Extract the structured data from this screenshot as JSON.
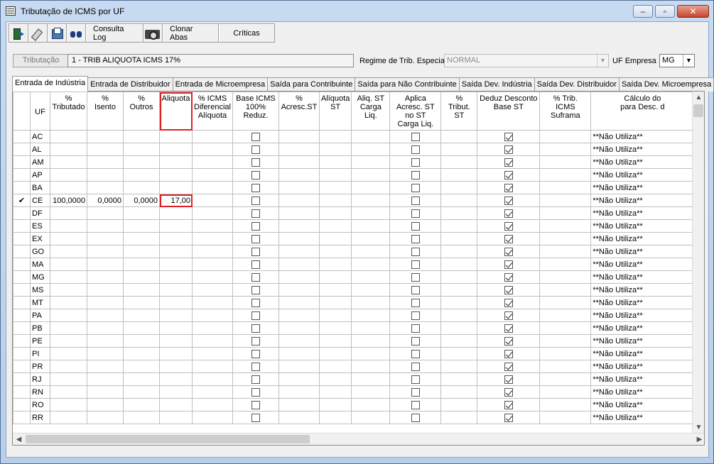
{
  "window": {
    "title": "Tributação de ICMS por UF"
  },
  "toolbar": {
    "consulta_log": "Consulta Log",
    "clonar_abas": "Clonar Abas",
    "criticas": "Críticas"
  },
  "form": {
    "tributacao_label": "Tributação",
    "tributacao_value": "1  -  TRIB ALIQUOTA ICMS 17%",
    "regime_label": "Regime de Trib. Especial",
    "regime_value": "NORMAL",
    "uf_empresa_label": "UF Empresa",
    "uf_empresa_value": "MG"
  },
  "tabs": [
    {
      "label": "Entrada de Indústria"
    },
    {
      "label": "Entrada de Distribuidor"
    },
    {
      "label": "Entrada de Microempresa"
    },
    {
      "label": "Saída para Contribuinte"
    },
    {
      "label": "Saída para Não Contribuinte"
    },
    {
      "label": "Saída Dev. Indústria"
    },
    {
      "label": "Saída Dev. Distribuidor"
    },
    {
      "label": "Saída Dev. Microempresa"
    }
  ],
  "grid": {
    "columns": [
      "UF",
      "%\nTributado",
      "%\nIsento",
      "%\nOutros",
      "Aliquota",
      "% ICMS\nDiferencial\nAlíquota",
      "Base ICMS\n100% Reduz.",
      "%\nAcresc.ST",
      "Alíquota\nST",
      "Aliq. ST\nCarga Liq.",
      "Aplica\nAcresc. ST\nno ST\nCarga Liq.",
      "%\nTribut. ST",
      "Deduz Desconto\nBase ST",
      "% Trib.\nICMS Suframa",
      "Cálculo do\npara Desc. d"
    ],
    "calc_text": "**Não Utiliza**",
    "rows": [
      {
        "uf": "AC",
        "trib": "",
        "isento": "",
        "outros": "",
        "aliq": "",
        "current": false
      },
      {
        "uf": "AL",
        "trib": "",
        "isento": "",
        "outros": "",
        "aliq": "",
        "current": false
      },
      {
        "uf": "AM",
        "trib": "",
        "isento": "",
        "outros": "",
        "aliq": "",
        "current": false
      },
      {
        "uf": "AP",
        "trib": "",
        "isento": "",
        "outros": "",
        "aliq": "",
        "current": false
      },
      {
        "uf": "BA",
        "trib": "",
        "isento": "",
        "outros": "",
        "aliq": "",
        "current": false
      },
      {
        "uf": "CE",
        "trib": "100,0000",
        "isento": "0,0000",
        "outros": "0,0000",
        "aliq": "17,00",
        "current": true
      },
      {
        "uf": "DF",
        "trib": "",
        "isento": "",
        "outros": "",
        "aliq": "",
        "current": false
      },
      {
        "uf": "ES",
        "trib": "",
        "isento": "",
        "outros": "",
        "aliq": "",
        "current": false
      },
      {
        "uf": "EX",
        "trib": "",
        "isento": "",
        "outros": "",
        "aliq": "",
        "current": false
      },
      {
        "uf": "GO",
        "trib": "",
        "isento": "",
        "outros": "",
        "aliq": "",
        "current": false
      },
      {
        "uf": "MA",
        "trib": "",
        "isento": "",
        "outros": "",
        "aliq": "",
        "current": false
      },
      {
        "uf": "MG",
        "trib": "",
        "isento": "",
        "outros": "",
        "aliq": "",
        "current": false
      },
      {
        "uf": "MS",
        "trib": "",
        "isento": "",
        "outros": "",
        "aliq": "",
        "current": false
      },
      {
        "uf": "MT",
        "trib": "",
        "isento": "",
        "outros": "",
        "aliq": "",
        "current": false
      },
      {
        "uf": "PA",
        "trib": "",
        "isento": "",
        "outros": "",
        "aliq": "",
        "current": false
      },
      {
        "uf": "PB",
        "trib": "",
        "isento": "",
        "outros": "",
        "aliq": "",
        "current": false
      },
      {
        "uf": "PE",
        "trib": "",
        "isento": "",
        "outros": "",
        "aliq": "",
        "current": false
      },
      {
        "uf": "PI",
        "trib": "",
        "isento": "",
        "outros": "",
        "aliq": "",
        "current": false
      },
      {
        "uf": "PR",
        "trib": "",
        "isento": "",
        "outros": "",
        "aliq": "",
        "current": false
      },
      {
        "uf": "RJ",
        "trib": "",
        "isento": "",
        "outros": "",
        "aliq": "",
        "current": false
      },
      {
        "uf": "RN",
        "trib": "",
        "isento": "",
        "outros": "",
        "aliq": "",
        "current": false
      },
      {
        "uf": "RO",
        "trib": "",
        "isento": "",
        "outros": "",
        "aliq": "",
        "current": false
      },
      {
        "uf": "RR",
        "trib": "",
        "isento": "",
        "outros": "",
        "aliq": "",
        "current": false
      }
    ]
  }
}
